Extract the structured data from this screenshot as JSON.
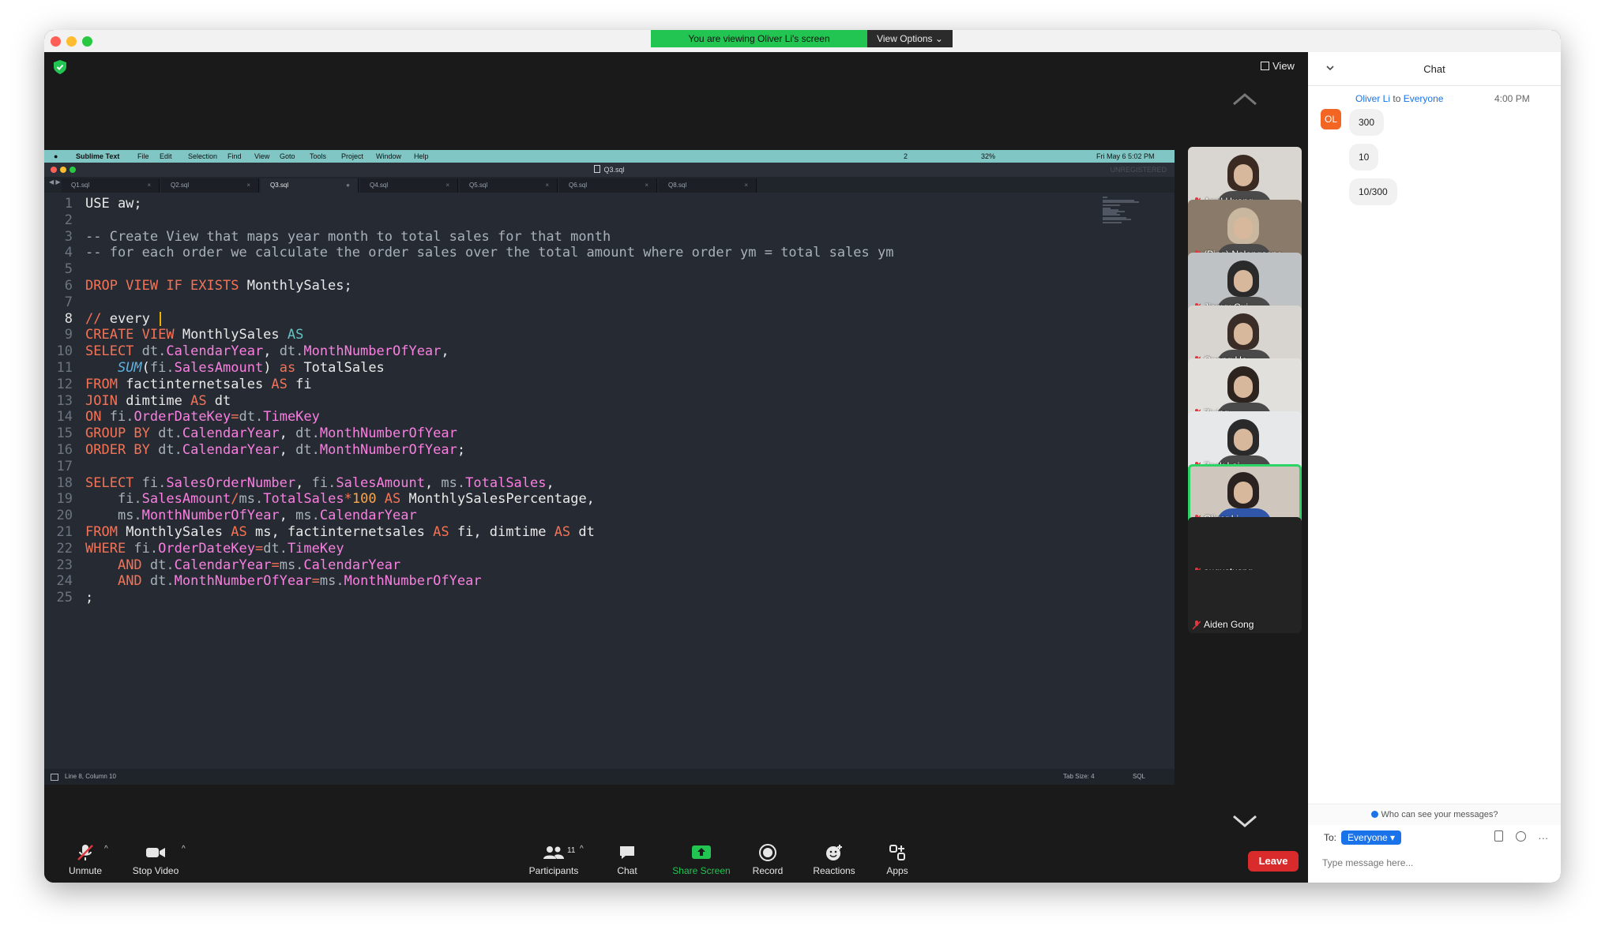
{
  "zoom": {
    "banner_text": "You are viewing Oliver Li's screen",
    "view_options_label": "View Options ⌄",
    "view_label": "View"
  },
  "shared_screen": {
    "mac_menu": [
      "Sublime Text",
      "File",
      "Edit",
      "Selection",
      "Find",
      "View",
      "Goto",
      "Tools",
      "Project",
      "Window",
      "Help"
    ],
    "mac_status": {
      "wechat_count": "2",
      "battery": "32%",
      "datetime": "Fri May 6  5:02 PM"
    },
    "editor_title": "Q3.sql",
    "tabs": [
      "Q1.sql",
      "Q2.sql",
      "Q3.sql",
      "Q4.sql",
      "Q5.sql",
      "Q6.sql",
      "Q8.sql"
    ],
    "active_tab": "Q3.sql",
    "status_left": "Line 8, Column 10",
    "status_tab": "Tab Size: 4",
    "status_lang": "SQL",
    "unregistered": "UNREGISTERED"
  },
  "code_lines": [
    {
      "n": "1",
      "t": [
        [
          "kw2",
          "USE aw;"
        ]
      ]
    },
    {
      "n": "2",
      "t": []
    },
    {
      "n": "3",
      "t": [
        [
          "cm",
          "-- Create View that maps year month to total sales for that month"
        ]
      ]
    },
    {
      "n": "4",
      "t": [
        [
          "cm",
          "-- for each order we calculate the order sales over the total amount where order ym = total sales ym"
        ]
      ]
    },
    {
      "n": "5",
      "t": []
    },
    {
      "n": "6",
      "t": [
        [
          "kw",
          "DROP VIEW IF EXISTS "
        ],
        [
          "id",
          "MonthlySales;"
        ]
      ]
    },
    {
      "n": "7",
      "t": []
    },
    {
      "n": "8",
      "t": [
        [
          "kw",
          "// "
        ],
        [
          "id",
          "every "
        ]
      ],
      "cursor": true
    },
    {
      "n": "9",
      "t": [
        [
          "kw",
          "CREATE VIEW "
        ],
        [
          "id",
          "MonthlySales "
        ],
        [
          "cy",
          "AS"
        ]
      ]
    },
    {
      "n": "10",
      "t": [
        [
          "kw",
          "SELECT "
        ],
        [
          "cm",
          "dt."
        ],
        [
          "mag",
          "CalendarYear"
        ],
        [
          "id",
          ", "
        ],
        [
          "cm",
          "dt."
        ],
        [
          "mag",
          "MonthNumberOfYear"
        ],
        [
          "id",
          ","
        ]
      ]
    },
    {
      "n": "11",
      "t": [
        [
          "id",
          "    "
        ],
        [
          "fn",
          "SUM"
        ],
        [
          "id",
          "("
        ],
        [
          "cm",
          "fi."
        ],
        [
          "mag",
          "SalesAmount"
        ],
        [
          "id",
          ") "
        ],
        [
          "kw",
          "as "
        ],
        [
          "id",
          "TotalSales"
        ]
      ]
    },
    {
      "n": "12",
      "t": [
        [
          "kw",
          "FROM "
        ],
        [
          "id",
          "factinternetsales "
        ],
        [
          "kw",
          "AS "
        ],
        [
          "id",
          "fi"
        ]
      ]
    },
    {
      "n": "13",
      "t": [
        [
          "kw",
          "JOIN "
        ],
        [
          "id",
          "dimtime "
        ],
        [
          "kw",
          "AS "
        ],
        [
          "id",
          "dt"
        ]
      ]
    },
    {
      "n": "14",
      "t": [
        [
          "kw",
          "ON "
        ],
        [
          "cm",
          "fi."
        ],
        [
          "mag",
          "OrderDateKey"
        ],
        [
          "kw",
          "="
        ],
        [
          "cm",
          "dt."
        ],
        [
          "mag",
          "TimeKey"
        ]
      ]
    },
    {
      "n": "15",
      "t": [
        [
          "kw",
          "GROUP BY "
        ],
        [
          "cm",
          "dt."
        ],
        [
          "mag",
          "CalendarYear"
        ],
        [
          "id",
          ", "
        ],
        [
          "cm",
          "dt."
        ],
        [
          "mag",
          "MonthNumberOfYear"
        ]
      ]
    },
    {
      "n": "16",
      "t": [
        [
          "kw",
          "ORDER BY "
        ],
        [
          "cm",
          "dt."
        ],
        [
          "mag",
          "CalendarYear"
        ],
        [
          "id",
          ", "
        ],
        [
          "cm",
          "dt."
        ],
        [
          "mag",
          "MonthNumberOfYear"
        ],
        [
          "id",
          ";"
        ]
      ]
    },
    {
      "n": "17",
      "t": []
    },
    {
      "n": "18",
      "t": [
        [
          "kw",
          "SELECT "
        ],
        [
          "cm",
          "fi."
        ],
        [
          "mag",
          "SalesOrderNumber"
        ],
        [
          "id",
          ", "
        ],
        [
          "cm",
          "fi."
        ],
        [
          "mag",
          "SalesAmount"
        ],
        [
          "id",
          ", "
        ],
        [
          "cm",
          "ms."
        ],
        [
          "mag",
          "TotalSales"
        ],
        [
          "id",
          ","
        ]
      ]
    },
    {
      "n": "19",
      "t": [
        [
          "id",
          "    "
        ],
        [
          "cm",
          "fi."
        ],
        [
          "mag",
          "SalesAmount"
        ],
        [
          "kw",
          "/"
        ],
        [
          "cm",
          "ms."
        ],
        [
          "mag",
          "TotalSales"
        ],
        [
          "kw",
          "*"
        ],
        [
          "num",
          "100 "
        ],
        [
          "kw",
          "AS "
        ],
        [
          "id",
          "MonthlySalesPercentage,"
        ]
      ]
    },
    {
      "n": "20",
      "t": [
        [
          "id",
          "    "
        ],
        [
          "cm",
          "ms."
        ],
        [
          "mag",
          "MonthNumberOfYear"
        ],
        [
          "id",
          ", "
        ],
        [
          "cm",
          "ms."
        ],
        [
          "mag",
          "CalendarYear"
        ]
      ]
    },
    {
      "n": "21",
      "t": [
        [
          "kw",
          "FROM "
        ],
        [
          "id",
          "MonthlySales "
        ],
        [
          "kw",
          "AS "
        ],
        [
          "id",
          "ms, factinternetsales "
        ],
        [
          "kw",
          "AS "
        ],
        [
          "id",
          "fi, dimtime "
        ],
        [
          "kw",
          "AS "
        ],
        [
          "id",
          "dt"
        ]
      ]
    },
    {
      "n": "22",
      "t": [
        [
          "kw",
          "WHERE "
        ],
        [
          "cm",
          "fi."
        ],
        [
          "mag",
          "OrderDateKey"
        ],
        [
          "kw",
          "="
        ],
        [
          "cm",
          "dt."
        ],
        [
          "mag",
          "TimeKey"
        ]
      ]
    },
    {
      "n": "23",
      "t": [
        [
          "id",
          "    "
        ],
        [
          "kw",
          "AND "
        ],
        [
          "cm",
          "dt."
        ],
        [
          "mag",
          "CalendarYear"
        ],
        [
          "kw",
          "="
        ],
        [
          "cm",
          "ms."
        ],
        [
          "mag",
          "CalendarYear"
        ]
      ]
    },
    {
      "n": "24",
      "t": [
        [
          "id",
          "    "
        ],
        [
          "kw",
          "AND "
        ],
        [
          "cm",
          "dt."
        ],
        [
          "mag",
          "MonthNumberOfYear"
        ],
        [
          "kw",
          "="
        ],
        [
          "cm",
          "ms."
        ],
        [
          "mag",
          "MonthNumberOfYear"
        ]
      ]
    },
    {
      "n": "25",
      "t": [
        [
          "id",
          ";"
        ]
      ]
    }
  ],
  "participants": [
    {
      "name": "April Huang",
      "video": true,
      "bg": "#d9d6d2",
      "face": "#3a2a22"
    },
    {
      "name": "(Ping) Nalongsone...",
      "video": true,
      "bg": "#8a7a6a",
      "face": "#c9b79f"
    },
    {
      "name": "Jianyu Cui",
      "video": true,
      "bg": "#bfc2c5",
      "face": "#2a2a2a"
    },
    {
      "name": "Quang Ho",
      "video": true,
      "bg": "#d8d4cf",
      "face": "#3a2c26"
    },
    {
      "name": "Ziying",
      "video": true,
      "bg": "#e2e0dc",
      "face": "#2e241f"
    },
    {
      "name": "Zack Lai",
      "video": true,
      "bg": "#e6e8ea",
      "face": "#2a2a2a"
    },
    {
      "name": "Oliver Li",
      "video": true,
      "bg": "#cfc7bd",
      "face": "#2a2220",
      "active": true
    },
    {
      "name": "augustusng",
      "video": false
    },
    {
      "name": "Aiden Gong",
      "video": false
    }
  ],
  "toolbar": {
    "unmute": "Unmute",
    "stop_video": "Stop Video",
    "participants": "Participants",
    "participants_count": "11",
    "chat": "Chat",
    "share_screen": "Share Screen",
    "record": "Record",
    "reactions": "Reactions",
    "apps": "Apps",
    "leave": "Leave"
  },
  "chat": {
    "title": "Chat",
    "from": "Oliver Li",
    "to_word": "to",
    "to": "Everyone",
    "time": "4:00 PM",
    "avatar_initials": "OL",
    "messages": [
      "300",
      "10",
      "10/300"
    ],
    "who_can_see": "Who can see your messages?",
    "to_label": "To:",
    "recipient": "Everyone",
    "placeholder": "Type message here..."
  },
  "colors": {
    "zoom_green": "#23c552",
    "leave_red": "#d92b2b",
    "chat_blue": "#1a73e8",
    "menubar_teal": "#7fc6c4"
  }
}
